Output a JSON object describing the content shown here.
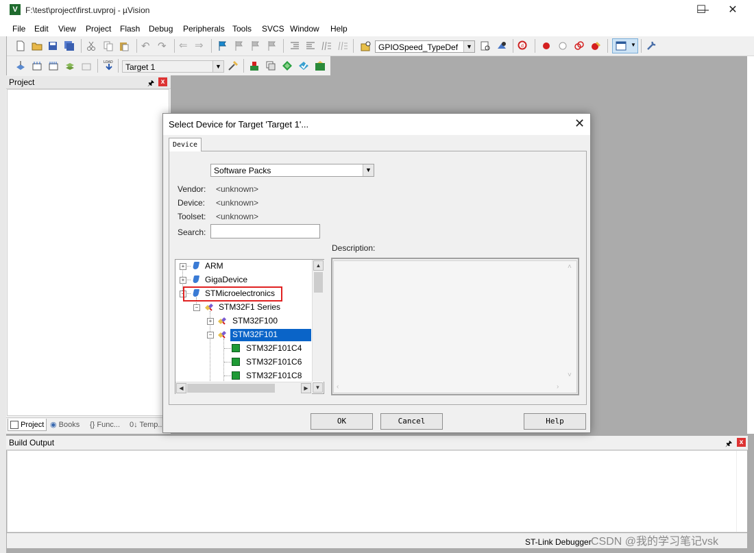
{
  "window": {
    "title": "F:\\test\\project\\first.uvproj - µVision",
    "app_icon_letter": "V",
    "minimize": "—",
    "maximize": "☐",
    "close": "✕"
  },
  "menu": [
    "File",
    "Edit",
    "View",
    "Project",
    "Flash",
    "Debug",
    "Peripherals",
    "Tools",
    "SVCS",
    "Window",
    "Help"
  ],
  "toolbar": {
    "find_combo": "GPIOSpeed_TypeDef",
    "target_combo": "Target 1"
  },
  "project_panel": {
    "title": "Project",
    "pin": "ᵖ",
    "close": "x",
    "tabs": [
      "Project",
      "Books",
      "{} Func...",
      "0↓ Temp..."
    ]
  },
  "build_output": {
    "title": "Build Output",
    "close": "x"
  },
  "status": {
    "debugger": "ST-Link Debugger"
  },
  "watermark": "CSDN @我的学习笔记vsk",
  "dialog": {
    "title": "Select Device for Target 'Target 1'...",
    "close": "✕",
    "tab": "Device",
    "pack_select": "Software Packs",
    "vendor_label": "Vendor:",
    "vendor_value": "<unknown>",
    "device_label": "Device:",
    "device_value": "<unknown>",
    "toolset_label": "Toolset:",
    "toolset_value": "<unknown>",
    "search_label": "Search:",
    "search_value": "",
    "description_label": "Description:",
    "tree": {
      "vendors": [
        "ARM",
        "GigaDevice",
        "STMicroelectronics"
      ],
      "series": "STM32F1 Series",
      "families": [
        "STM32F100",
        "STM32F101"
      ],
      "devices": [
        "STM32F101C4",
        "STM32F101C6",
        "STM32F101C8"
      ],
      "selected": "STM32F101",
      "highlighted_vendor": "STMicroelectronics"
    },
    "buttons": {
      "ok": "OK",
      "cancel": "Cancel",
      "help": "Help"
    }
  },
  "colors": {
    "selection": "#0a64c8",
    "highlight_box": "#e02020",
    "workspace_bg": "#ababab"
  }
}
